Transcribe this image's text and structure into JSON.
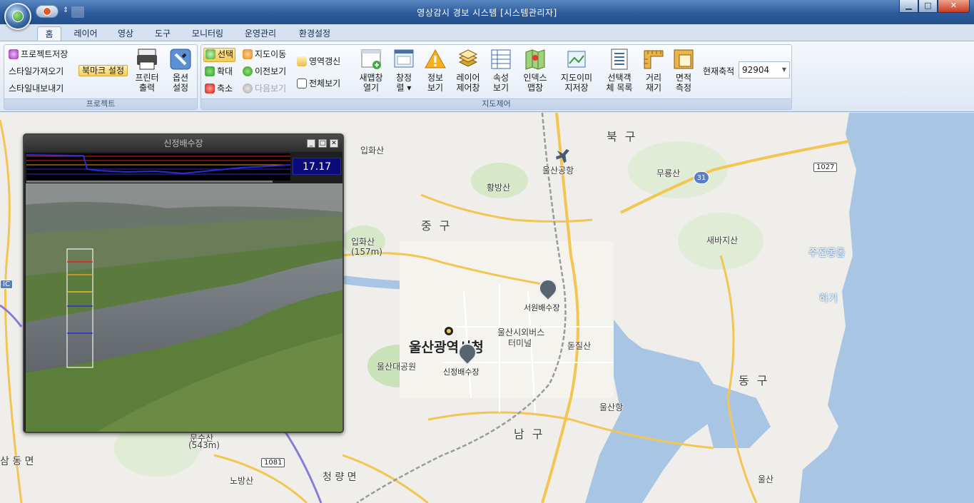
{
  "window": {
    "title": "영상감시 경보 시스템 [시스템관리자]",
    "minimize_symbol": "▁",
    "maximize_symbol": "□",
    "close_symbol": "✕",
    "qat_arrow": "⇕"
  },
  "tabs": [
    "홈",
    "레이어",
    "영상",
    "도구",
    "모니터링",
    "운영관리",
    "환경설정"
  ],
  "ribbon": {
    "project": {
      "caption": "프로젝트",
      "save": "프로젝트저장",
      "style_import": "스타일가져오기",
      "style_export": "스타일내보내기",
      "bookmark": "북마크 설정",
      "printer": [
        "프린터",
        "출력"
      ],
      "options": [
        "옵션",
        "설정"
      ]
    },
    "map_control": {
      "caption": "지도제어",
      "select": "선택",
      "zoom_in": "확대",
      "zoom_out": "축소",
      "pan": "지도이동",
      "prev_view": "이전보기",
      "next_view": "다음보기",
      "refresh_area": "영역갱신",
      "full_view": "전체보기",
      "new_map": [
        "새맵창",
        "열기"
      ],
      "window_list": [
        "창정",
        "렬 ▾"
      ],
      "info_view": [
        "정보",
        "보기"
      ],
      "layer_control": [
        "레이어",
        "제어창"
      ],
      "attr_view": [
        "속성",
        "보기"
      ],
      "index_map": [
        "인덱스",
        "맵창"
      ],
      "map_image_save": [
        "지도이미",
        "지저장"
      ],
      "selected_list": [
        "선택객",
        "체 목록"
      ],
      "distance": [
        "거리",
        "재기"
      ],
      "area": [
        "면적",
        "측정"
      ],
      "scale_label": "현재축적",
      "scale_value": "92904"
    }
  },
  "map": {
    "labels": {
      "bukgu": "북 구",
      "junggu": "중 구",
      "donggu": "동 구",
      "namgu": "남 구",
      "ipwhasan1": "입화산",
      "ipwhasan2": "입화산",
      "ipwhasan2_elev": "(157m)",
      "hwangbangsan": "황방산",
      "airport": "울산공항",
      "mubongsan": "무룡산",
      "saebaji": "새바지산",
      "jujeon": "주전몽돌",
      "haki": "하기",
      "city_hall": "울산광역시청",
      "grand_park": "울산대공원",
      "bus_terminal_1": "울산시외버스",
      "bus_terminal_2": "터미널",
      "dojilsan": "돋질산",
      "ulsan_port": "울산항",
      "ulsan_east": "울산",
      "samdong": "삼 동 면",
      "munsusan": "문수산",
      "munsusan_elev": "(543m)",
      "nobangsan": "노방산",
      "cheongryang": "청 량 면",
      "ic_label": "IC",
      "road_1081": "1081",
      "road_1027": "1027",
      "route_31": "31"
    },
    "pins": {
      "seowon": "서원배수장",
      "sinjeong": "신정배수장"
    }
  },
  "popup": {
    "title": "신정배수장",
    "level_value": "17.17",
    "min_symbol": "_",
    "max_symbol": "□",
    "close_symbol": "✕"
  },
  "colors": {
    "accent_blue": "#2c5a9a",
    "graph_line": "#2b2bd8",
    "level_red": "#d22",
    "level_orange": "#e8a020",
    "level_blue": "#2a2ad0"
  }
}
